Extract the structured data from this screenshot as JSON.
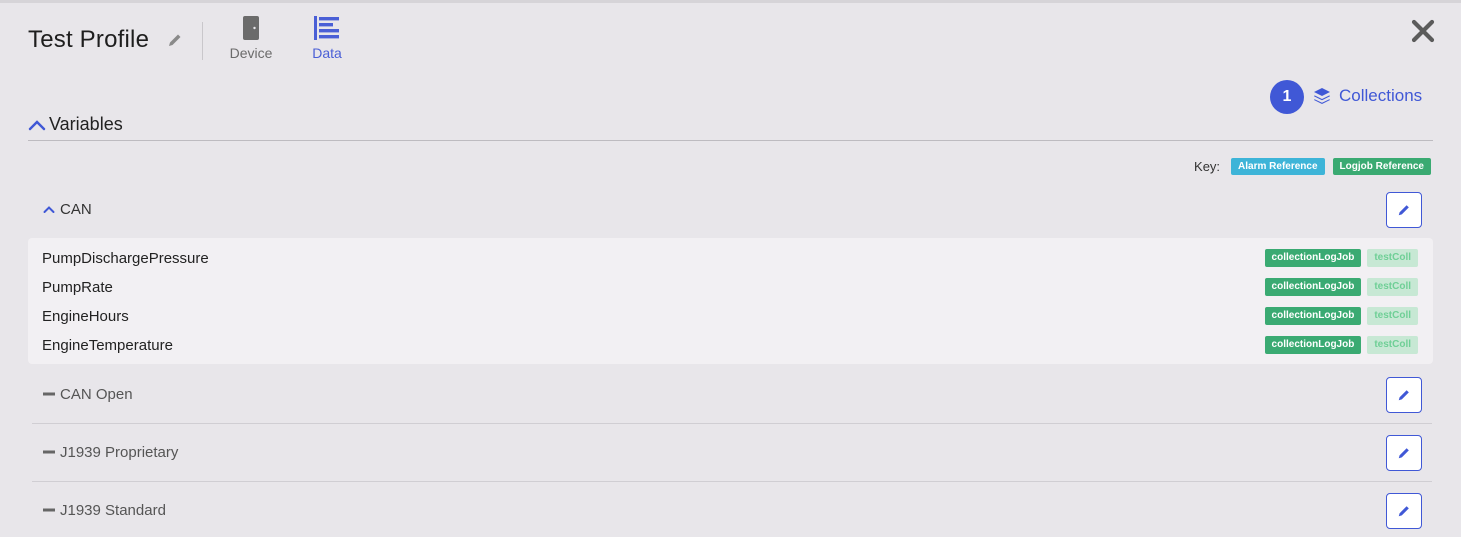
{
  "header": {
    "title": "Test Profile",
    "tabs": [
      {
        "label": "Device",
        "icon": "device-icon",
        "active": false
      },
      {
        "label": "Data",
        "icon": "data-icon",
        "active": true
      }
    ],
    "close_icon": "close-icon"
  },
  "collections": {
    "count": "1",
    "label": "Collections",
    "icon": "layers-icon"
  },
  "variables": {
    "title": "Variables",
    "key": {
      "label": "Key:",
      "alarm_label": "Alarm Reference",
      "logjob_label": "Logjob Reference"
    },
    "groups": [
      {
        "name": "CAN",
        "expanded": true,
        "items": [
          {
            "name": "PumpDischargePressure",
            "tags": [
              "collectionLogJob",
              "testColl"
            ]
          },
          {
            "name": "PumpRate",
            "tags": [
              "collectionLogJob",
              "testColl"
            ]
          },
          {
            "name": "EngineHours",
            "tags": [
              "collectionLogJob",
              "testColl"
            ]
          },
          {
            "name": "EngineTemperature",
            "tags": [
              "collectionLogJob",
              "testColl"
            ]
          }
        ]
      },
      {
        "name": "CAN Open",
        "expanded": false
      },
      {
        "name": "J1939 Proprietary",
        "expanded": false
      },
      {
        "name": "J1939 Standard",
        "expanded": false
      }
    ]
  },
  "colors": {
    "accent": "#4058d6",
    "alarm": "#3db4d8",
    "logjob": "#3aaa72",
    "coll_tag_bg": "#c7e8d4",
    "coll_tag_text": "#6fcf96",
    "background": "#e8e6ea"
  }
}
